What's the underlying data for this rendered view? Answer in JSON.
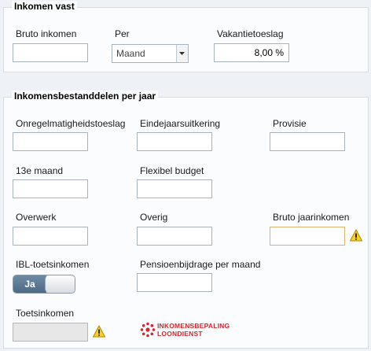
{
  "fixed_income": {
    "title": "Inkomen vast",
    "gross_income_label": "Bruto inkomen",
    "gross_income_value": "",
    "per_label": "Per",
    "per_value": "Maand",
    "holiday_label": "Vakantietoeslag",
    "holiday_value": "8,00 %"
  },
  "components": {
    "title": "Inkomensbestanddelen per jaar",
    "irregularity_label": "Onregelmatigheidstoeslag",
    "year_end_label": "Eindejaarsuitkering",
    "commission_label": "Provisie",
    "thirteenth_month_label": "13e maand",
    "flexible_budget_label": "Flexibel budget",
    "overtime_label": "Overwerk",
    "other_label": "Overig",
    "gross_annual_label": "Bruto jaarinkomen",
    "ibl_label": "IBL-toetsinkomen",
    "ibl_toggle_text": "Ja",
    "pension_label": "Pensioenbijdrage per maand",
    "test_income_label": "Toetsinkomen"
  },
  "logo": {
    "line1": "INKOMENSBEPALING",
    "line2": "LOONDIENST"
  },
  "icons": {
    "warning": "warning-icon",
    "dropdown": "chevron-down-icon",
    "logo_mark": "ibl-logo-icon"
  },
  "colors": {
    "warning_border": "#e0b36a",
    "toggle_on": "#5a7590",
    "logo_red": "#d7262e"
  }
}
